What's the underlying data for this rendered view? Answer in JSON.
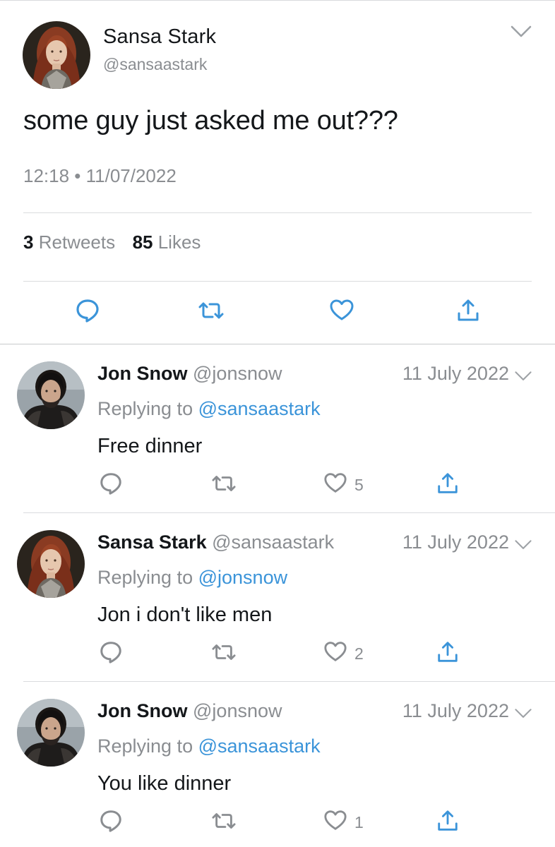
{
  "main_tweet": {
    "author_name": "Sansa Stark",
    "author_handle": "@sansaastark",
    "text": "some guy just asked me out???",
    "timestamp": "12:18 • 11/07/2022",
    "retweets_count": "3",
    "retweets_label": "Retweets",
    "likes_count": "85",
    "likes_label": "Likes"
  },
  "replies": [
    {
      "author_name": "Jon Snow",
      "author_handle": "@jonsnow",
      "date": "11 July 2022",
      "replying_label": "Replying to",
      "replying_to": "@sansaastark",
      "text": "Free dinner",
      "like_count": "5",
      "avatar": "jon"
    },
    {
      "author_name": "Sansa Stark",
      "author_handle": "@sansaastark",
      "date": "11 July 2022",
      "replying_label": "Replying to",
      "replying_to": "@jonsnow",
      "text": "Jon i don't like men",
      "like_count": "2",
      "avatar": "sansa"
    },
    {
      "author_name": "Jon Snow",
      "author_handle": "@jonsnow",
      "date": "11 July 2022",
      "replying_label": "Replying to",
      "replying_to": "@sansaastark",
      "text": "You like dinner",
      "like_count": "1",
      "avatar": "jon"
    }
  ],
  "colors": {
    "text_primary": "#14171a",
    "text_secondary": "#8a8d91",
    "mention_blue": "#3b94d9",
    "icon_gray": "#8a8d91",
    "icon_blue": "#3b94d9"
  },
  "icons": [
    "reply-icon",
    "retweet-icon",
    "like-icon",
    "share-icon",
    "chevron-down-icon"
  ]
}
